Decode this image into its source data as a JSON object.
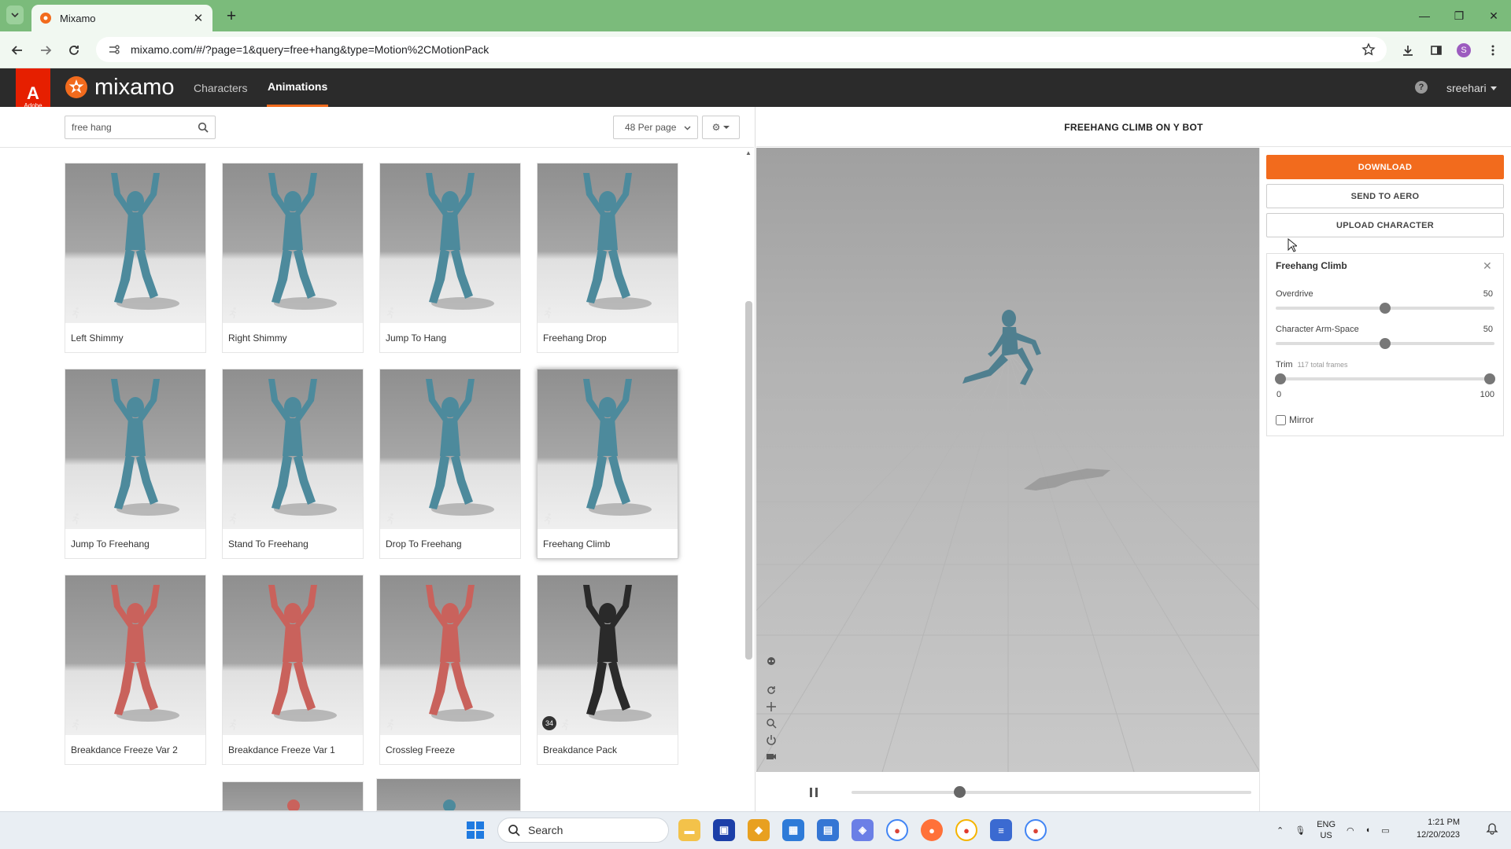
{
  "browser": {
    "tab_title": "Mixamo",
    "url": "mixamo.com/#/?page=1&query=free+hang&type=Motion%2CMotionPack",
    "profile_initial": "S"
  },
  "header": {
    "adobe_text": "Adobe",
    "brand": "mixamo",
    "nav": [
      "Characters",
      "Animations"
    ],
    "active_nav": "Animations",
    "user": "sreehari"
  },
  "search": {
    "query": "free hang",
    "per_page": "48 Per page"
  },
  "cards": [
    {
      "label": "Left Shimmy",
      "color": "#4d8a9c"
    },
    {
      "label": "Right Shimmy",
      "color": "#4d8a9c"
    },
    {
      "label": "Jump To Hang",
      "color": "#4d8a9c"
    },
    {
      "label": "Freehang Drop",
      "color": "#4d8a9c"
    },
    {
      "label": "Jump To Freehang",
      "color": "#4d8a9c"
    },
    {
      "label": "Stand To Freehang",
      "color": "#4d8a9c"
    },
    {
      "label": "Drop To Freehang",
      "color": "#4d8a9c"
    },
    {
      "label": "Freehang Climb",
      "color": "#4d8a9c",
      "selected": true
    },
    {
      "label": "Breakdance Freeze Var 2",
      "color": "#c9625c"
    },
    {
      "label": "Breakdance Freeze Var 1",
      "color": "#c9625c"
    },
    {
      "label": "Crossleg Freeze",
      "color": "#c9625c"
    },
    {
      "label": "Breakdance Pack",
      "color": "#2a2a2a",
      "badge": "34"
    }
  ],
  "viewport": {
    "title": "FREEHANG CLIMB ON Y BOT",
    "timeline_progress": 0.27
  },
  "panel": {
    "download": "DOWNLOAD",
    "send_to_aero": "SEND TO AERO",
    "upload_character": "UPLOAD CHARACTER",
    "settings_title": "Freehang Climb",
    "overdrive_label": "Overdrive",
    "overdrive_value": "50",
    "overdrive_level": 0.5,
    "armspace_label": "Character Arm-Space",
    "armspace_value": "50",
    "armspace_level": 0.5,
    "trim_label": "Trim",
    "trim_note": "117 total frames",
    "trim_min": "0",
    "trim_max": "100",
    "mirror_label": "Mirror"
  },
  "taskbar": {
    "search_placeholder": "Search",
    "lang_top": "ENG",
    "lang_bottom": "US",
    "time": "1:21 PM",
    "date": "12/20/2023"
  },
  "colors": {
    "accent": "#f26b1d",
    "appbar": "#2b2b2b",
    "browser_frame": "#7bbb7b",
    "adobe_red": "#e61f00"
  }
}
